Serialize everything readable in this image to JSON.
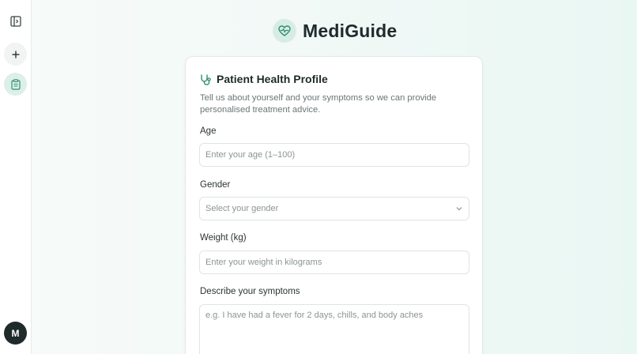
{
  "brand": {
    "title": "MediGuide",
    "accent": "#2f8f73"
  },
  "sidebar": {
    "avatar_initial": "M"
  },
  "card": {
    "title": "Patient Health Profile",
    "description": "Tell us about yourself and your symptoms so we can provide personalised treatment advice."
  },
  "form": {
    "age": {
      "label": "Age",
      "placeholder": "Enter your age (1–100)"
    },
    "gender": {
      "label": "Gender",
      "placeholder": "Select your gender"
    },
    "weight": {
      "label": "Weight (kg)",
      "placeholder": "Enter your weight in kilograms"
    },
    "symptoms": {
      "label": "Describe your symptoms",
      "placeholder": "e.g. I have had a fever for 2 days, chills, and body aches"
    }
  }
}
